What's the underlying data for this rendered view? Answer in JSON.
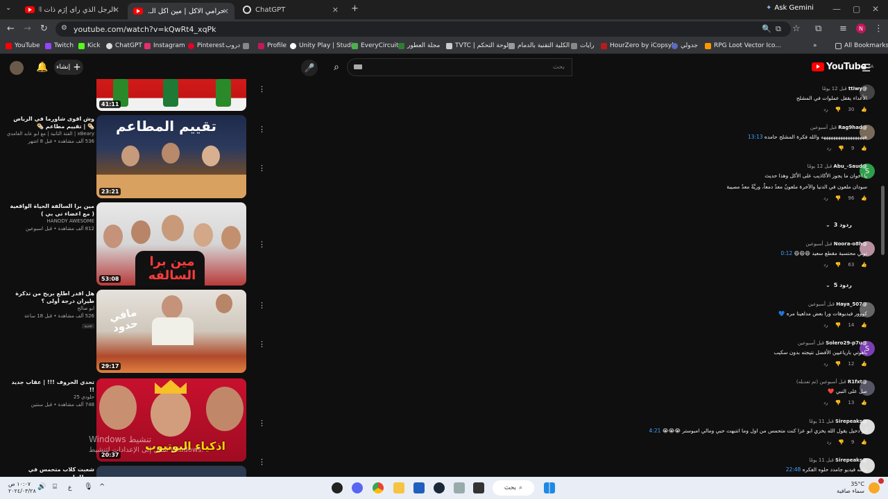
{
  "browser": {
    "tabs": [
      {
        "label": "الرجل الذي رأى إرَم ذات العماد : ..."
      },
      {
        "label": "حرامي الاكل | مين اكل الـ... 🤫"
      },
      {
        "label": "ChatGPT"
      }
    ],
    "new_tab": "+",
    "gemini": "Ask Gemini",
    "url": "youtube.com/watch?v=kQwRt4_xqPk",
    "bookmarks": [
      "YouTube",
      "Twitch",
      "Kick",
      "ChatGPT",
      "Instagram",
      "Pinterest",
      "دروب",
      "Profile",
      "Unity Play | Studio",
      "EveryCircuit",
      "مجلة العطور",
      "TVTC | لوحة التحكم",
      "الكلية التقنية بالدمام",
      "رايات",
      "HourZero by iCopsyle",
      "جدولي",
      "RPG Loot Vector Ico..."
    ],
    "all_bookmarks": "All Bookmarks"
  },
  "youtube": {
    "create": "إنشاء",
    "search_placeholder": "بحث",
    "logo": "YouTube",
    "logo_region": "SA"
  },
  "related": [
    {
      "duration": "41:11",
      "title": "",
      "channel": "",
      "stats": ""
    },
    {
      "duration": "23:21",
      "thumb_text": "تقييم المطاعم",
      "title": "وش اقوى شاورما في الرياض 🌯 | تقييم مطاعم 🌯",
      "channel": "xBeary | الفتة الثانية | مع ابو عابد الغامدي",
      "stats": "536 ألف مشاهدة • قبل 8 اشهر"
    },
    {
      "duration": "53:08",
      "thumb_text": "مين برا السالفه",
      "title": "مين برا السالفة الحياة الواقعية ( مع اعضاء تي بي )",
      "channel": "HANODY AWESOME",
      "stats": "812 ألف مشاهدة • قبل اسبوعين"
    },
    {
      "duration": "29:17",
      "thumb_text": "مافي حدود",
      "title": "هل اقدر اطلع بريح من تذكرة طيران درجة أولى ؟",
      "channel": "ابو صالح",
      "stats": "526 ألف مشاهدة • قبل 18 ساعة",
      "badge": "جديد"
    },
    {
      "duration": "20:37",
      "thumb_text": "اذكياء اليوتيوب",
      "title": "تحدي الحروف !!! | عقاب جديد !!",
      "channel": "حلودي 25",
      "stats": "748 ألف مشاهدة • قبل سنتين"
    },
    {
      "title": "شعبت كلاب متحمس في بريطانيا"
    }
  ],
  "comments": [
    {
      "user": "@ttiwy",
      "time": "قبل 12 يومًا",
      "text": "الأعداء يقفل عملوات في المشلح",
      "likes": "30",
      "reply": "رد",
      "avatar_color": "#444"
    },
    {
      "user": "@Rag9had",
      "time": "قبل أسبوعين",
      "ts": "13:13",
      "text": "ههههههههههههههههههه والله فكرة المشلح حامده",
      "likes": "9",
      "reply": "رد",
      "avatar_color": "#7a6a5a"
    },
    {
      "user": "@Abu_-Saud",
      "time": "قبل 12 يومًا",
      "text": "يا اخوان ما يجوز الأكاذيب على الأكل وهذا حديث",
      "text2": "سودان ملعون في الدنيا والآخرة ملعونٌ معدٌ دمعاً، وريَّةٌ معدٌ مصيبة",
      "likes": "96",
      "reply": "رد",
      "avatar_letter": "S",
      "avatar_color": "#2e9e4a",
      "replies": "3 ردود"
    },
    {
      "user": "@Noora-o8h",
      "time": "قبل أسبوعين",
      "ts": "0:12",
      "text": "توني محتسبة مقطع سعيد 😄😄😄",
      "likes": "63",
      "reply": "رد",
      "avatar_color": "#b88fa0",
      "replies": "5 ردود"
    },
    {
      "user": "@Haya_507",
      "time": "قبل أسبوعين",
      "text": "كووور فيديوهات ورا بعض مدلعينا مره 💙",
      "likes": "14",
      "reply": "رد",
      "avatar_color": "#666"
    },
    {
      "user": "@Solero29-p7u",
      "time": "قبل أسبوعين",
      "text": "باهوتي بارياعيين الأفضل نتيجته بدون سكيب",
      "likes": "12",
      "reply": "رد",
      "avatar_letter": "S",
      "avatar_color": "#7b3fb2"
    },
    {
      "user": "@R1fxt",
      "time": "قبل أسبوعين (تم تعديله)",
      "text": "صل على النبي ❤️",
      "likes": "13",
      "reply": "رد",
      "avatar_color": "#556"
    },
    {
      "user": "@Sirepeaks",
      "time": "قبل 11 يومًا",
      "ts": "4:21",
      "text": "أبو دحيل يقول الله يخزي ابو عزا كنت متحمس من اول وما انتبهت حبي ومالي امبوستر 😭😭😭",
      "likes": "9",
      "reply": "رد",
      "avatar_color": "#ddd"
    },
    {
      "user": "@Sirepeaks",
      "time": "قبل 11 يومًا",
      "ts": "22:48",
      "text": "والله فيديو جامدد حلوه الفكره",
      "avatar_color": "#ddd"
    }
  ],
  "windows_watermark": {
    "line1": "Windows تنشيط",
    "line2": "انتقل إلى الإعدادات لتنشيط Windows."
  },
  "taskbar": {
    "search": "بحث",
    "time": "١٠:٠٧ ص",
    "date": "٢٠٢٤/٠٣/٢٨",
    "lang": "ع",
    "temp": "35°C",
    "weather": "سماء صافية"
  }
}
